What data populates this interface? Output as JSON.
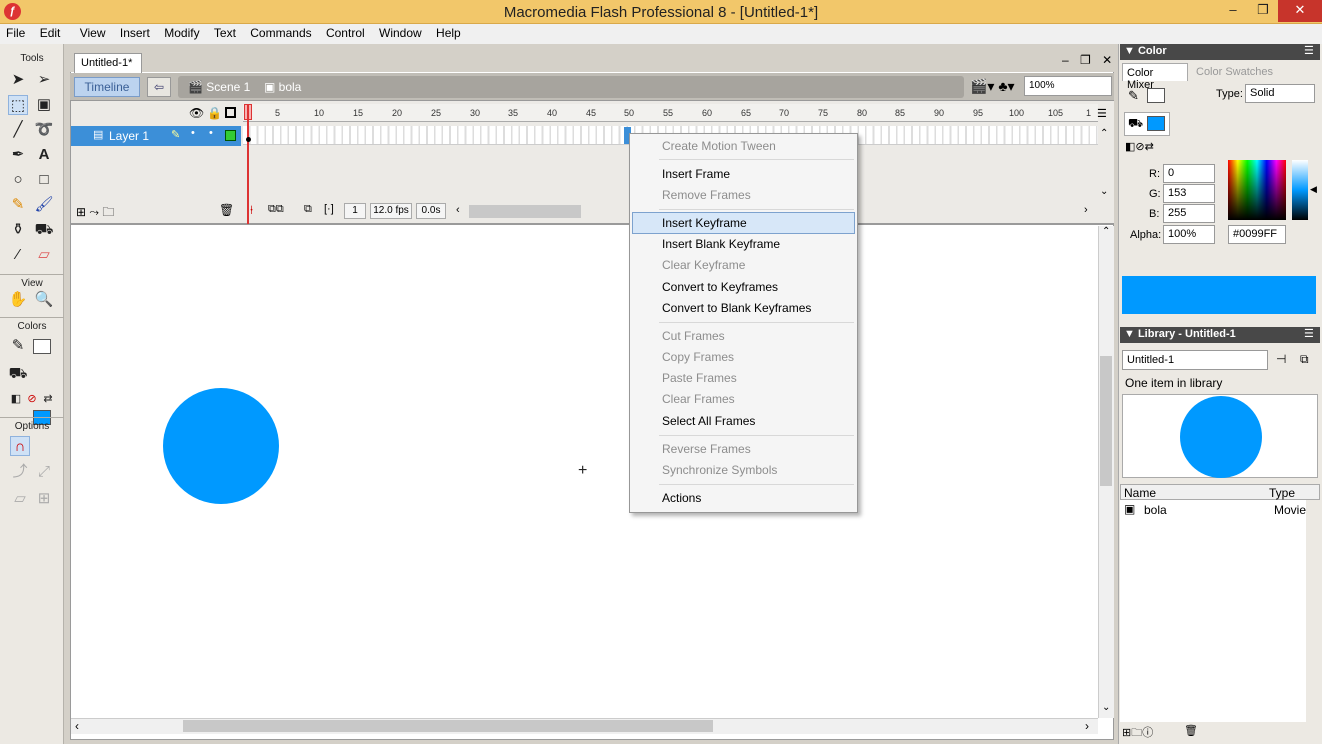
{
  "window": {
    "title": "Macromedia Flash Professional 8 - [Untitled-1*]",
    "min": "–",
    "max": "❐",
    "close": "✕"
  },
  "menu": [
    "File",
    "Edit",
    "View",
    "Insert",
    "Modify",
    "Text",
    "Commands",
    "Control",
    "Window",
    "Help"
  ],
  "tools": {
    "header": "Tools",
    "view_header": "View",
    "colors_header": "Colors",
    "options_header": "Options"
  },
  "document": {
    "tab": "Untitled-1*",
    "timeline_button": "Timeline",
    "scene": "Scene 1",
    "symbol": "bola",
    "zoom": "100%",
    "controls": "– ❐ ✕"
  },
  "timeline": {
    "layer_name": "Layer 1",
    "ruler": [
      "5",
      "10",
      "15",
      "20",
      "25",
      "30",
      "35",
      "40",
      "45",
      "50",
      "55",
      "60",
      "65",
      "70",
      "75",
      "80",
      "85",
      "90",
      "95",
      "100",
      "105",
      "1"
    ],
    "current_frame": "1",
    "fps": "12.0 fps",
    "time": "0.0s"
  },
  "context_menu": [
    {
      "label": "Create Motion Tween",
      "enabled": false
    },
    {
      "label": "Insert Frame",
      "enabled": true
    },
    {
      "label": "Remove Frames",
      "enabled": false
    },
    {
      "label": "Insert Keyframe",
      "enabled": true,
      "highlighted": true
    },
    {
      "label": "Insert Blank Keyframe",
      "enabled": true
    },
    {
      "label": "Clear Keyframe",
      "enabled": false
    },
    {
      "label": "Convert to Keyframes",
      "enabled": true
    },
    {
      "label": "Convert to Blank Keyframes",
      "enabled": true
    },
    {
      "label": "Cut Frames",
      "enabled": false
    },
    {
      "label": "Copy Frames",
      "enabled": false
    },
    {
      "label": "Paste Frames",
      "enabled": false
    },
    {
      "label": "Clear Frames",
      "enabled": false
    },
    {
      "label": "Select All Frames",
      "enabled": true
    },
    {
      "label": "Reverse Frames",
      "enabled": false
    },
    {
      "label": "Synchronize Symbols",
      "enabled": false
    },
    {
      "label": "Actions",
      "enabled": true
    }
  ],
  "color_panel": {
    "title": "▼ Color",
    "tab_mixer": "Color Mixer",
    "tab_swatches": "Color Swatches",
    "type_label": "Type:",
    "type_value": "Solid",
    "r_label": "R:",
    "r": "0",
    "g_label": "G:",
    "g": "153",
    "b_label": "B:",
    "b": "255",
    "alpha_label": "Alpha:",
    "alpha": "100%",
    "hex": "#0099FF",
    "fill_color": "#0099ff"
  },
  "library_panel": {
    "title": "▼ Library - Untitled-1",
    "document": "Untitled-1",
    "count": "One item in library",
    "col_name": "Name",
    "col_type": "Type",
    "items": [
      {
        "name": "bola",
        "type": "Movie"
      }
    ]
  }
}
